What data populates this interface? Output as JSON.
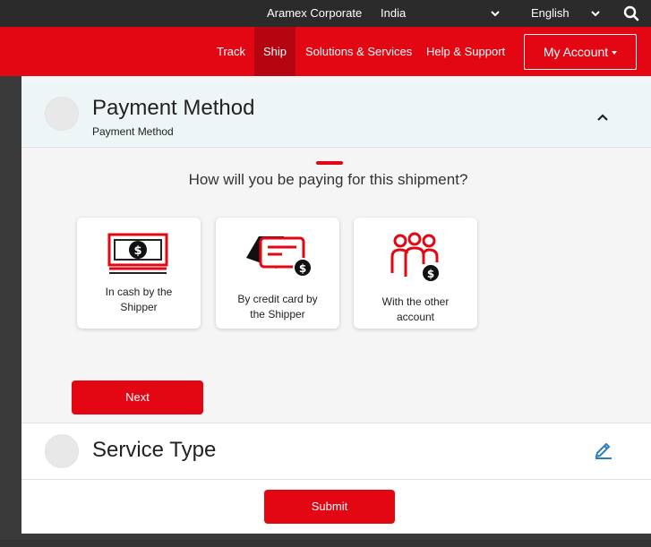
{
  "topbar": {
    "corporate_label": "Aramex Corporate",
    "country": "India",
    "language": "English"
  },
  "nav": {
    "items": [
      "Track",
      "Ship",
      "Solutions & Services",
      "Help & Support"
    ],
    "account_label": "My Account"
  },
  "payment": {
    "title": "Payment Method",
    "subtitle": "Payment Method",
    "question": "How will you be paying for this shipment?",
    "options": [
      {
        "line1": "In cash by the",
        "line2": "Shipper"
      },
      {
        "line1": "By credit card by",
        "line2": "the Shipper"
      },
      {
        "line1": "With the other",
        "line2": "account"
      }
    ],
    "next_label": "Next"
  },
  "service": {
    "title": "Service Type"
  },
  "submit_label": "Submit",
  "colors": {
    "brand": "#e30613",
    "edit": "#2a7dbf"
  }
}
